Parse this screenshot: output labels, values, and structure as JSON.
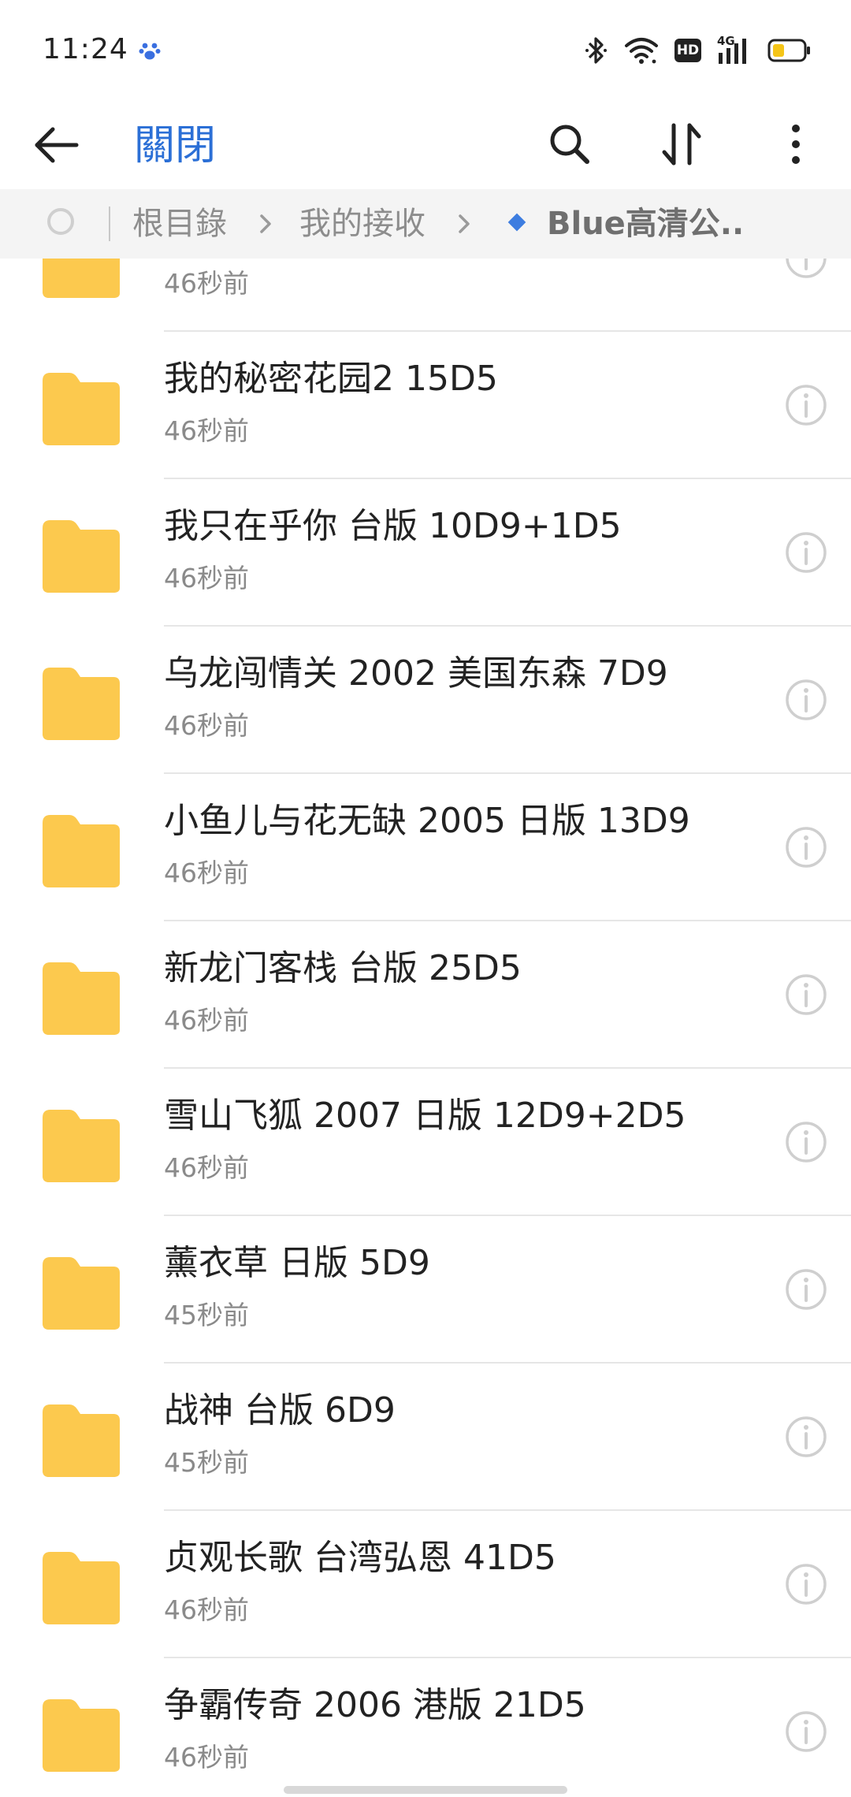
{
  "status_bar": {
    "time": "11:24",
    "hd_label": "HD",
    "network_label": "4G"
  },
  "app_bar": {
    "close_label": "關閉"
  },
  "breadcrumb": {
    "items": [
      "根目錄",
      "我的接收"
    ],
    "current": "Blue高清公..."
  },
  "colors": {
    "accent": "#2b6fd6",
    "folder": "#fcc94e",
    "battery": "#f5c518"
  },
  "files": {
    "partial": {
      "time": "46秒前"
    },
    "items": [
      {
        "name": "我的秘密花园2 15D5",
        "time": "46秒前"
      },
      {
        "name": "我只在乎你 台版 10D9+1D5",
        "time": "46秒前"
      },
      {
        "name": "乌龙闯情关 2002 美国东森 7D9",
        "time": "46秒前"
      },
      {
        "name": "小鱼儿与花无缺 2005 日版 13D9",
        "time": "46秒前"
      },
      {
        "name": "新龙门客栈 台版 25D5",
        "time": "46秒前"
      },
      {
        "name": "雪山飞狐 2007 日版 12D9+2D5",
        "time": "46秒前"
      },
      {
        "name": "薰衣草 日版 5D9",
        "time": "45秒前"
      },
      {
        "name": "战神 台版 6D9",
        "time": "45秒前"
      },
      {
        "name": "贞观长歌 台湾弘恩 41D5",
        "time": "46秒前"
      },
      {
        "name": "争霸传奇 2006 港版 21D5",
        "time": "46秒前"
      }
    ]
  }
}
